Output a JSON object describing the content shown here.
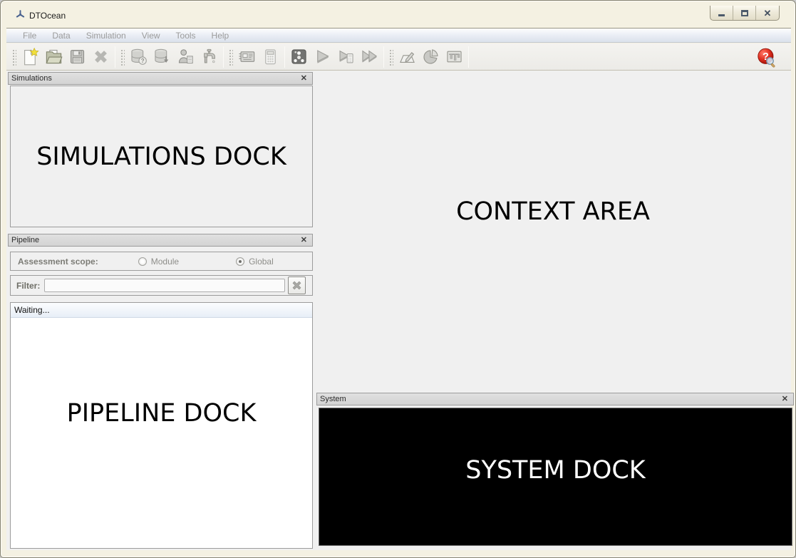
{
  "window": {
    "title": "DTOcean",
    "controls": {
      "minimize": "minimize",
      "maximize": "maximize",
      "close": "close"
    }
  },
  "glyphs": {
    "close_window": "✕",
    "close_dock": "✕"
  },
  "menubar": {
    "items": [
      "File",
      "Data",
      "Simulation",
      "View",
      "Tools",
      "Help"
    ]
  },
  "toolbar": {
    "icons": [
      "new-project",
      "open-project",
      "save-project",
      "close-project",
      "database-query",
      "database-export",
      "user-data",
      "data-tap",
      "system-card",
      "calculator",
      "strategy-manager",
      "run-simulation",
      "run-module",
      "run-strategy",
      "annotate",
      "pie-chart",
      "timeline",
      "help-search"
    ]
  },
  "simulations_dock": {
    "title": "Simulations",
    "placeholder": "SIMULATIONS DOCK"
  },
  "pipeline_dock": {
    "title": "Pipeline",
    "scope_label": "Assessment scope:",
    "scope_options": [
      {
        "label": "Module",
        "selected": false
      },
      {
        "label": "Global",
        "selected": true
      }
    ],
    "filter_label": "Filter:",
    "filter_value": "",
    "status_text": "Waiting...",
    "placeholder": "PIPELINE DOCK"
  },
  "context_area": {
    "placeholder": "CONTEXT AREA"
  },
  "system_dock": {
    "title": "System",
    "placeholder": "SYSTEM DOCK"
  },
  "colors": {
    "frame": "#f4f1e2",
    "menu_disabled_text": "#9b9b9b",
    "dock_title_bg": "#d7d7d7",
    "workspace_bg": "#f0f0f0",
    "console_bg": "#000000",
    "console_text": "#ffffff",
    "help_red": "#cc1f1f",
    "star_yellow": "#f2e03c"
  }
}
